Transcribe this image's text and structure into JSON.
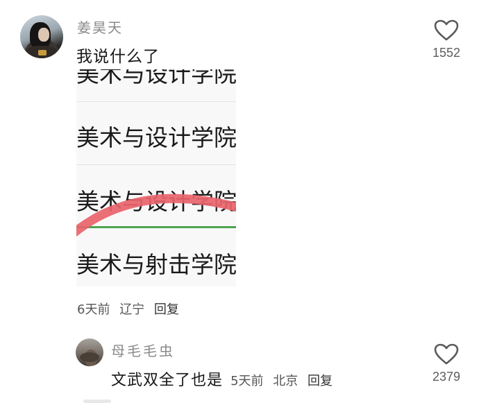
{
  "comments": [
    {
      "username": "姜昊天",
      "text": "我说什么了",
      "time": "6天前",
      "location": "辽宁",
      "reply_label": "回复",
      "likes": "1552",
      "like_icon": "heart-outline-icon",
      "embedded_image": {
        "rows": [
          "美术与设计学院",
          "美术与设计学院",
          "美术与设计学院",
          "美术与射击学院"
        ],
        "marker_color": "#e8636b",
        "underline_color": "#4ea34f"
      }
    },
    {
      "username": "母毛毛虫",
      "text": "文武双全了也是",
      "time": "5天前",
      "location": "北京",
      "reply_label": "回复",
      "likes": "2379",
      "like_icon": "heart-outline-icon"
    }
  ]
}
